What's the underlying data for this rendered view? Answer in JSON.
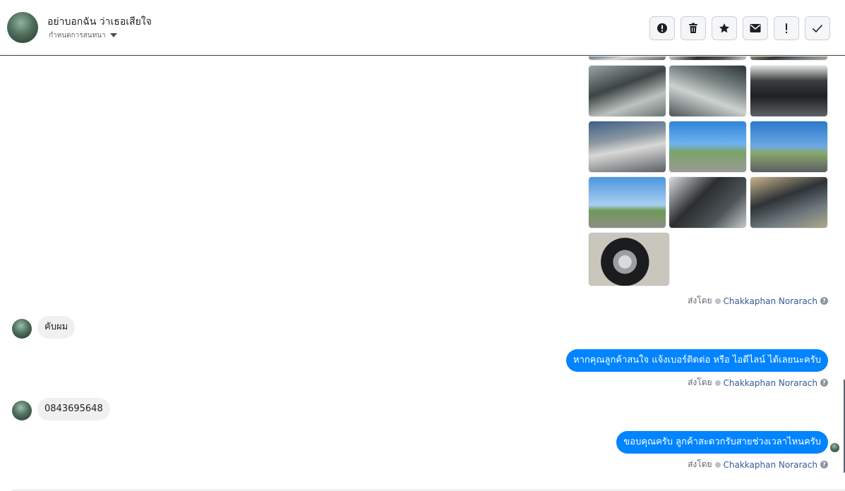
{
  "header": {
    "contact_name": "อย่าบอกฉัน ว่าเธอเสียใจ",
    "assign_label": "กำหนดการสนทนา"
  },
  "actions": [
    {
      "icon": "alert-circle-icon",
      "label": "Mark as spam"
    },
    {
      "icon": "trash-icon",
      "label": "Delete"
    },
    {
      "icon": "star-icon",
      "label": "Star"
    },
    {
      "icon": "envelope-icon",
      "label": "Mark as unread"
    },
    {
      "icon": "exclamation-icon",
      "label": "Follow up"
    },
    {
      "icon": "check-icon",
      "label": "Mark as done"
    }
  ],
  "messages": {
    "sent_by_prefix": "ส่งโดย",
    "sender_name": "Chakkaphan Norarach",
    "incoming_1": "คับผม",
    "outgoing_1": "หากคุณลูกค้าสนใจ แจ้งเบอร์ติดต่อ หรือ ไอดีไลน์ ได้เลยนะครับ",
    "incoming_2": "0843695648",
    "outgoing_2": "ขอบคุณครับ ลูกค้าสะดวกรับสายช่วงเวลาไหนครับ"
  },
  "photos": [
    {
      "subject": "truck-interior"
    },
    {
      "subject": "gear-console"
    },
    {
      "subject": "underbody"
    },
    {
      "subject": "engine-bay"
    },
    {
      "subject": "truck-side-rack"
    },
    {
      "subject": "truck-profile"
    },
    {
      "subject": "truck-rear"
    },
    {
      "subject": "door-panel"
    },
    {
      "subject": "dashboard"
    },
    {
      "subject": "wheel"
    }
  ]
}
